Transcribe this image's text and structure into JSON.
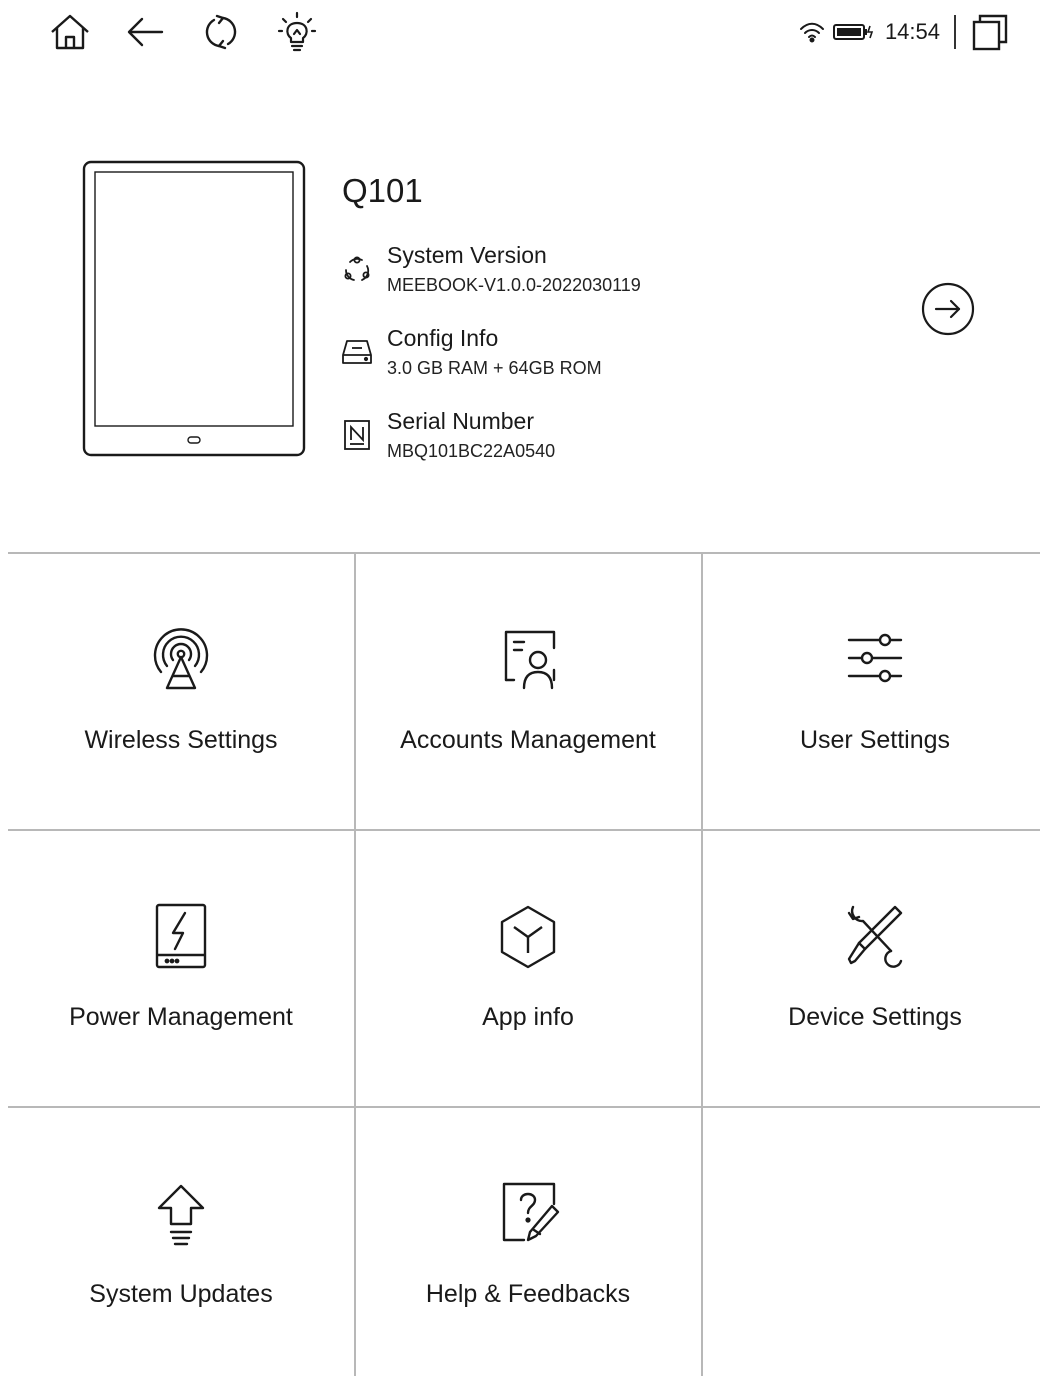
{
  "status_bar": {
    "home_icon": "home-icon",
    "back_icon": "back-arrow-icon",
    "refresh_icon": "refresh-icon",
    "light_icon": "lightbulb-icon",
    "wifi_icon": "wifi-icon",
    "battery_icon": "battery-charging-icon",
    "clock": "14:54",
    "multitask_icon": "multitask-icon"
  },
  "device": {
    "name": "Q101",
    "info": [
      {
        "label": "System Version",
        "value": "MEEBOOK-V1.0.0-2022030119",
        "icon": "system-version-icon"
      },
      {
        "label": "Config Info",
        "value": "3.0 GB RAM +  64GB ROM",
        "icon": "storage-icon"
      },
      {
        "label": "Serial Number",
        "value": "MBQ101BC22A0540",
        "icon": "serial-number-icon"
      }
    ],
    "details_icon": "arrow-right-circle-icon"
  },
  "menu": [
    {
      "label": "Wireless Settings",
      "icon": "wireless-icon"
    },
    {
      "label": "Accounts Management",
      "icon": "accounts-icon"
    },
    {
      "label": "User Settings",
      "icon": "sliders-icon"
    },
    {
      "label": "Power Management",
      "icon": "power-icon"
    },
    {
      "label": "App info",
      "icon": "app-box-icon"
    },
    {
      "label": "Device Settings",
      "icon": "tools-icon"
    },
    {
      "label": "System Updates",
      "icon": "update-icon"
    },
    {
      "label": "Help & Feedbacks",
      "icon": "help-icon"
    }
  ],
  "colors": {
    "background": "#ffffff",
    "text": "#1a1a1a",
    "divider": "#b8b8b8"
  }
}
